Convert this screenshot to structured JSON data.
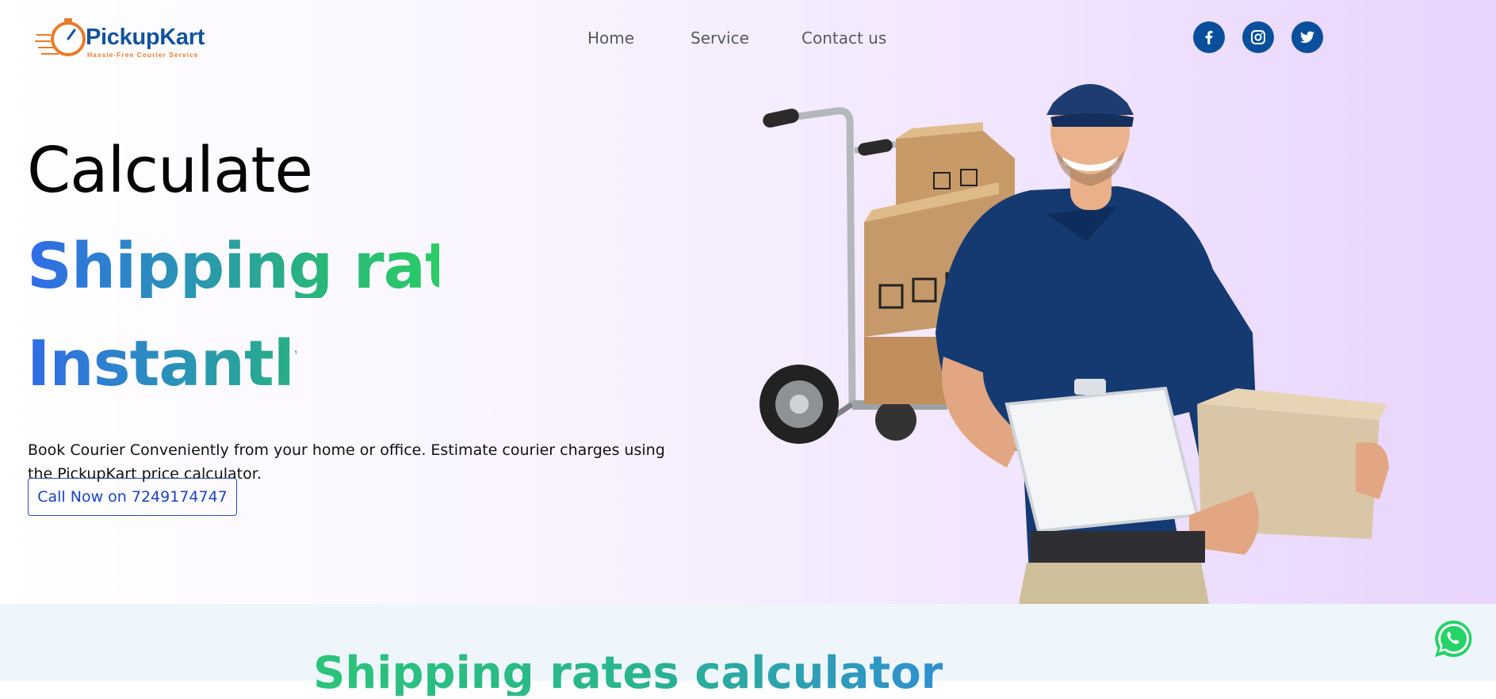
{
  "brand": {
    "name": "PickupKart",
    "tagline": "Hassle-Free Courier Service",
    "color": "#12539e",
    "accent": "#ea7b2a"
  },
  "nav": {
    "items": [
      "Home",
      "Service",
      "Contact us"
    ]
  },
  "social": {
    "icons": [
      "facebook-icon",
      "instagram-icon",
      "twitter-icon"
    ],
    "color": "#0a4f9c"
  },
  "hero": {
    "line1": "Calculate",
    "line2": "Shipping rate",
    "line3": "Instantly",
    "description": "Book Courier Conveniently from your home or office. Estimate courier charges using the PickupKart price calculator.",
    "cta_label": "Call Now on 7249174747",
    "gradient": [
      "#2f6ce8",
      "#2bcc66"
    ]
  },
  "section2": {
    "title": "Shipping rates calculator"
  },
  "floating": {
    "icon": "whatsapp-icon",
    "color": "#25d366"
  }
}
